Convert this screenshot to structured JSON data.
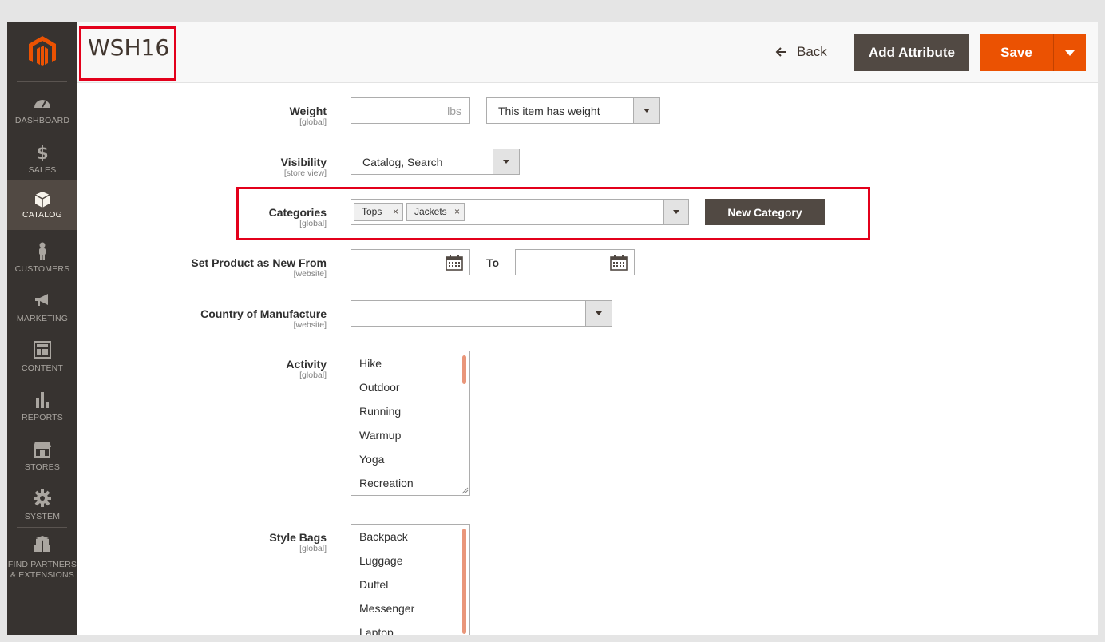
{
  "sidebar": {
    "items": [
      {
        "label": "DASHBOARD",
        "icon": "dashboard-icon"
      },
      {
        "label": "SALES",
        "icon": "dollar-icon"
      },
      {
        "label": "CATALOG",
        "icon": "box-icon"
      },
      {
        "label": "CUSTOMERS",
        "icon": "person-icon"
      },
      {
        "label": "MARKETING",
        "icon": "megaphone-icon"
      },
      {
        "label": "CONTENT",
        "icon": "layout-icon"
      },
      {
        "label": "REPORTS",
        "icon": "bar-chart-icon"
      },
      {
        "label": "STORES",
        "icon": "store-icon"
      },
      {
        "label": "SYSTEM",
        "icon": "gear-icon"
      },
      {
        "label_line1": "FIND PARTNERS",
        "label_line2": "& EXTENSIONS",
        "icon": "boxes-icon"
      }
    ],
    "active": "CATALOG"
  },
  "header": {
    "title": "WSH16",
    "back_label": "Back",
    "add_attribute_label": "Add Attribute",
    "save_label": "Save"
  },
  "form": {
    "weight": {
      "label": "Weight",
      "scope": "[global]",
      "value": "",
      "unit": "lbs",
      "select_value": "This item has weight"
    },
    "visibility": {
      "label": "Visibility",
      "scope": "[store view]",
      "value": "Catalog, Search"
    },
    "categories": {
      "label": "Categories",
      "scope": "[global]",
      "tags": [
        "Tops",
        "Jackets"
      ],
      "new_category_label": "New Category"
    },
    "new_from": {
      "label": "Set Product as New From",
      "scope": "[website]",
      "value": "",
      "to_label": "To",
      "to_value": ""
    },
    "country": {
      "label": "Country of Manufacture",
      "scope": "[website]",
      "value": ""
    },
    "activity": {
      "label": "Activity",
      "scope": "[global]",
      "options": [
        "Hike",
        "Outdoor",
        "Running",
        "Warmup",
        "Yoga",
        "Recreation"
      ]
    },
    "style_bags": {
      "label": "Style Bags",
      "scope": "[global]",
      "options": [
        "Backpack",
        "Luggage",
        "Duffel",
        "Messenger",
        "Laptop"
      ]
    }
  },
  "colors": {
    "accent": "#eb5202",
    "sidebar": "#373330",
    "highlight": "#e3001b",
    "dark_button": "#514943"
  }
}
